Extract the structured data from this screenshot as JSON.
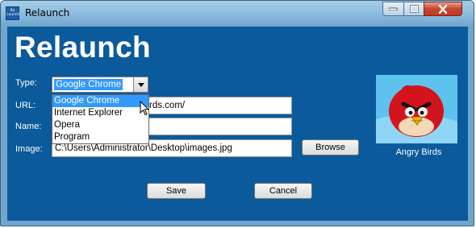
{
  "window": {
    "title": "Relaunch",
    "icon_text": "Re Launch",
    "icons": {
      "minimize": "minimize-icon",
      "maximize": "maximize-icon",
      "close": "close-icon"
    }
  },
  "header": {
    "title": "Relaunch"
  },
  "form": {
    "type_label": "Type:",
    "type_value": "Google Chrome",
    "type_options": [
      "Google Chrome",
      "Internet Explorer",
      "Opera",
      "Program"
    ],
    "url_label": "URL:",
    "url_value": "http://www.angrybirds.com/",
    "url_visible_tail": "rds.com/",
    "name_label": "Name:",
    "name_value": "",
    "image_label": "Image:",
    "image_value": "C:\\Users\\Administrator\\Desktop\\images.jpg",
    "browse_label": "Browse"
  },
  "preview": {
    "caption": "Angry Birds"
  },
  "actions": {
    "save_label": "Save",
    "cancel_label": "Cancel"
  },
  "colors": {
    "content_bg": "#0b5a9c",
    "titlebar": "#8ebedf",
    "selection": "#3399ff"
  }
}
